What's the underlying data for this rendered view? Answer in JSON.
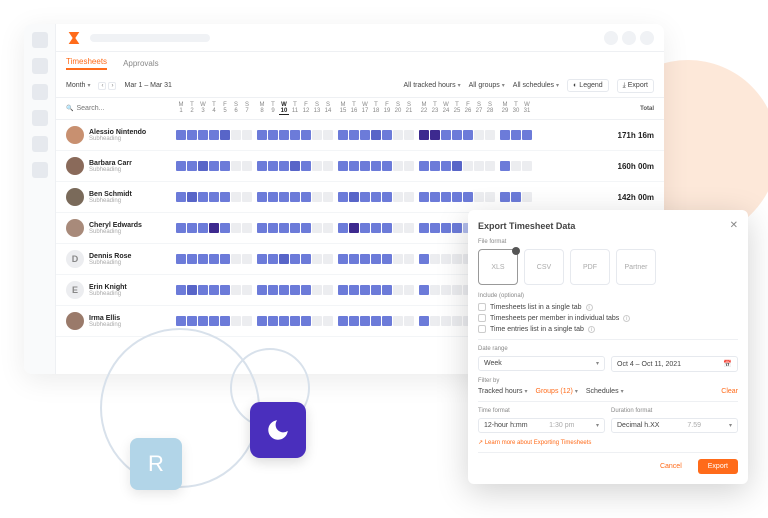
{
  "tabs": {
    "timesheets": "Timesheets",
    "approvals": "Approvals"
  },
  "controls": {
    "period": "Month",
    "range": "Mar 1 – Mar 31",
    "filter_hours": "All tracked hours",
    "filter_groups": "All groups",
    "filter_schedules": "All schedules",
    "legend": "Legend",
    "export": "Export"
  },
  "header": {
    "search_placeholder": "Search...",
    "days": [
      "M",
      "T",
      "W",
      "T",
      "F",
      "S",
      "S",
      "M",
      "T",
      "W",
      "T",
      "F",
      "S",
      "S",
      "M",
      "T",
      "W",
      "T",
      "F",
      "S",
      "S",
      "M",
      "T",
      "W",
      "T",
      "F",
      "S",
      "S",
      "M",
      "T",
      "W"
    ],
    "nums": [
      1,
      2,
      3,
      4,
      5,
      6,
      7,
      8,
      9,
      10,
      11,
      12,
      13,
      14,
      15,
      16,
      17,
      18,
      19,
      20,
      21,
      22,
      23,
      24,
      25,
      26,
      27,
      28,
      29,
      30,
      31
    ],
    "today_idx": 9,
    "total": "Total"
  },
  "rows": [
    {
      "name": "Alessio Nintendo",
      "sub": "Subheading",
      "total": "171h 16m",
      "letter": "",
      "cells": "f1,f1,f1,f1,f2,,,f1,f1,f1,f1,f1,,,f1,f1,f1,f2,f1,,,f3,f3,f1,f1,f1,,,f1,f1,f1"
    },
    {
      "name": "Barbara Carr",
      "sub": "Subheading",
      "total": "160h 00m",
      "letter": "",
      "cells": "f1,f1,f2,f1,f1,,,f1,f1,f1,f2,f1,,,f1,f1,f1,f1,f1,,,f1,f1,f1,f2,,,, f1,,"
    },
    {
      "name": "Ben Schmidt",
      "sub": "Subheading",
      "total": "142h 00m",
      "letter": "",
      "cells": "f1,f2,f1,f1,f1,,,f1,f1,f1,f1,f1,,,f1,f2,f1,f1,f1,,,f1,f1,f1,f1,f1,,,f1,f1,"
    },
    {
      "name": "Cheryl Edwards",
      "sub": "Subheading",
      "total": "",
      "letter": "",
      "cells": "f1,f1,f1,f3,f1,,,f1,f1,f1,f1,f1,,,f1,f3,f1,f1,f1,,,f1,f1,f1,f1,f4,,,f4,,"
    },
    {
      "name": "Dennis Rose",
      "sub": "Subheading",
      "total": "",
      "letter": "D",
      "cells": "f1,f1,f1,f1,f1,,,f1,f1,f2,f1,f1,,,f1,f1,f1,f1,f1,,,f1,,,,,,,,,"
    },
    {
      "name": "Erin Knight",
      "sub": "Subheading",
      "total": "",
      "letter": "E",
      "cells": "f1,f2,f1,f1,f1,,,f1,f1,f1,f1,f1,,,f1,f1,f1,f1,f1,,,f1,,,,,,,,,"
    },
    {
      "name": "Irma Ellis",
      "sub": "Subheading",
      "total": "",
      "letter": "",
      "cells": "f1,f1,f1,f1,f1,,,f1,f1,f1,f1,f1,,,f1,f1,f1,f1,f1,,,f1,,,,,,,,,"
    }
  ],
  "tiles": {
    "r": "R"
  },
  "modal": {
    "title": "Export Timesheet Data",
    "file_format": "File format",
    "formats": [
      "XLS",
      "CSV",
      "PDF",
      "Partner"
    ],
    "include": "Include (optional)",
    "inc1": "Timesheets list in a single tab",
    "inc2": "Timesheets per member in individual tabs",
    "inc3": "Time entries list in a single tab",
    "date_range": "Date range",
    "week": "Week",
    "date_val": "Oct 4 – Oct 11, 2021",
    "filter_by": "Filter by",
    "f_hours": "Tracked hours",
    "f_groups": "Groups (12)",
    "f_sched": "Schedules",
    "clear": "Clear",
    "time_format": "Time format",
    "tf_val": "12-hour h:mm",
    "tf_ex": "1:30 pm",
    "duration_format": "Duration format",
    "df_val": "Decimal h.XX",
    "df_ex": "7.59",
    "link": "Learn more about Exporting Timesheets",
    "cancel": "Cancel",
    "export": "Export"
  }
}
